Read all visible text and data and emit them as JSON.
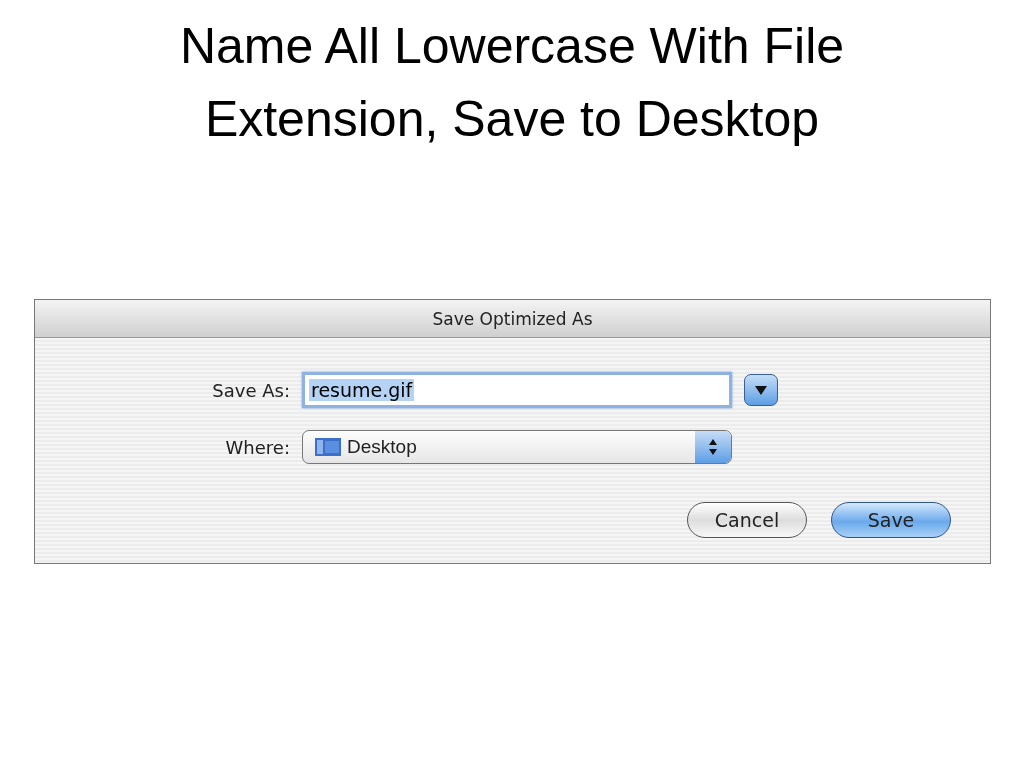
{
  "slide": {
    "title": "Name All Lowercase With File Extension, Save to Desktop"
  },
  "dialog": {
    "title": "Save Optimized As",
    "save_as": {
      "label": "Save As:",
      "value": "resume.gif",
      "selected": true
    },
    "where": {
      "label": "Where:",
      "value": "Desktop"
    },
    "buttons": [
      {
        "label": "Cancel",
        "default": false
      },
      {
        "label": "Save",
        "default": true
      }
    ]
  }
}
